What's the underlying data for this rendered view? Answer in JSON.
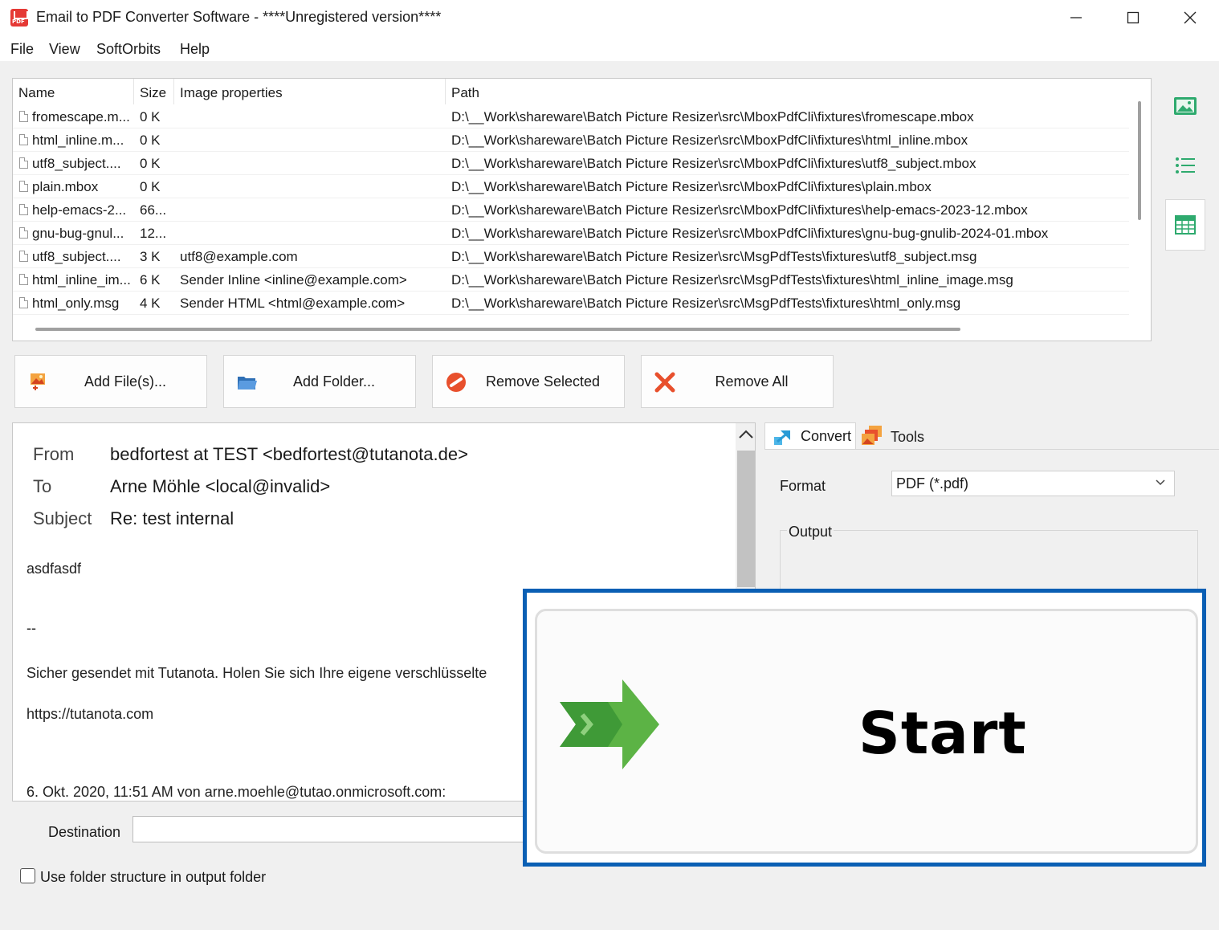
{
  "window": {
    "title": "Email to PDF Converter Software - ****Unregistered version****",
    "minimize": "—",
    "maximize": "☐",
    "close": "✕"
  },
  "menu": {
    "items": [
      "File",
      "View",
      "SoftOrbits",
      "Help"
    ]
  },
  "filelist": {
    "columns": [
      "Name",
      "Size",
      "Image properties",
      "Path"
    ],
    "rows": [
      {
        "name": "fromescape.m...",
        "size": "0 K",
        "props": "",
        "path": "D:\\__Work\\shareware\\Batch Picture Resizer\\src\\MboxPdfCli\\fixtures\\fromescape.mbox"
      },
      {
        "name": "html_inline.m...",
        "size": "0 K",
        "props": "",
        "path": "D:\\__Work\\shareware\\Batch Picture Resizer\\src\\MboxPdfCli\\fixtures\\html_inline.mbox"
      },
      {
        "name": "utf8_subject....",
        "size": "0 K",
        "props": "",
        "path": "D:\\__Work\\shareware\\Batch Picture Resizer\\src\\MboxPdfCli\\fixtures\\utf8_subject.mbox"
      },
      {
        "name": "plain.mbox",
        "size": "0 K",
        "props": "",
        "path": "D:\\__Work\\shareware\\Batch Picture Resizer\\src\\MboxPdfCli\\fixtures\\plain.mbox"
      },
      {
        "name": "help-emacs-2...",
        "size": "66...",
        "props": "",
        "path": "D:\\__Work\\shareware\\Batch Picture Resizer\\src\\MboxPdfCli\\fixtures\\help-emacs-2023-12.mbox"
      },
      {
        "name": "gnu-bug-gnul...",
        "size": "12...",
        "props": "",
        "path": "D:\\__Work\\shareware\\Batch Picture Resizer\\src\\MboxPdfCli\\fixtures\\gnu-bug-gnulib-2024-01.mbox"
      },
      {
        "name": "utf8_subject....",
        "size": "3 K",
        "props": "utf8@example.com",
        "path": "D:\\__Work\\shareware\\Batch Picture Resizer\\src\\MsgPdfTests\\fixtures\\utf8_subject.msg"
      },
      {
        "name": "html_inline_im...",
        "size": "6 K",
        "props": "Sender Inline <inline@example.com>",
        "path": "D:\\__Work\\shareware\\Batch Picture Resizer\\src\\MsgPdfTests\\fixtures\\html_inline_image.msg"
      },
      {
        "name": "html_only.msg",
        "size": "4 K",
        "props": "Sender HTML <html@example.com>",
        "path": "D:\\__Work\\shareware\\Batch Picture Resizer\\src\\MsgPdfTests\\fixtures\\html_only.msg"
      }
    ]
  },
  "buttons": {
    "add_files": "Add File(s)...",
    "add_folder": "Add Folder...",
    "remove_selected": "Remove Selected",
    "remove_all": "Remove All"
  },
  "preview": {
    "from_label": "From",
    "from_value": "bedfortest at TEST <bedfortest@tutanota.de>",
    "to_label": "To",
    "to_value": "Arne Möhle <local@invalid>",
    "subject_label": "Subject",
    "subject_value": "Re: test internal",
    "body": [
      "asdfasdf",
      "--",
      "Sicher gesendet mit Tutanota. Holen Sie sich Ihre eigene verschlüsselte",
      "https://tutanota.com",
      "6. Okt. 2020, 11:51 AM von arne.moehle@tutao.onmicrosoft.com:"
    ]
  },
  "tabs": {
    "convert": "Convert",
    "tools": "Tools"
  },
  "convert": {
    "format_label": "Format",
    "format_value": "PDF (*.pdf)",
    "output_label": "Output"
  },
  "destination": {
    "label": "Destination",
    "value": ""
  },
  "options": {
    "folder_structure_label": "Use folder structure in output folder",
    "folder_structure_checked": false
  },
  "start": {
    "label": "Start"
  },
  "colors": {
    "accent_blue": "#0a5fb4",
    "start_green": "#5cb345",
    "remove_red": "#e8502d"
  }
}
